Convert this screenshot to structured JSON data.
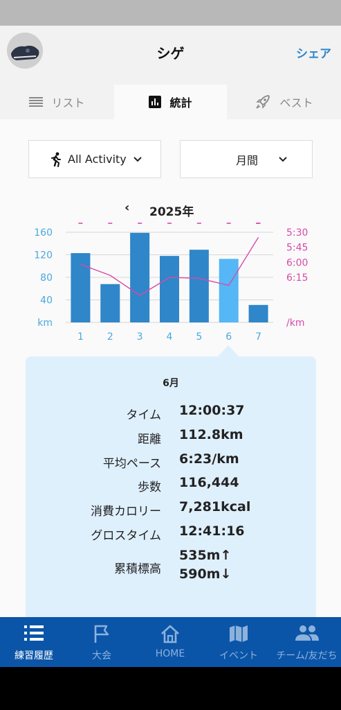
{
  "header": {
    "title": "シゲ",
    "share_label": "シェア"
  },
  "tabs": [
    {
      "label": "リスト",
      "icon": "list-icon"
    },
    {
      "label": "統計",
      "icon": "bar-chart-icon",
      "active": true
    },
    {
      "label": "ベスト",
      "icon": "rocket-icon"
    }
  ],
  "filters": {
    "activity": "All Activity",
    "period": "月間"
  },
  "chart_nav": {
    "year": "2025年"
  },
  "chart_data": {
    "type": "bar",
    "categories": [
      "1",
      "2",
      "3",
      "4",
      "5",
      "6",
      "7"
    ],
    "series": [
      {
        "values": [
          123,
          68,
          159,
          118,
          129,
          112.8,
          31
        ],
        "axis": "left",
        "unit": "km",
        "color": "#2f86c9"
      },
      {
        "values": [
          362,
          373,
          393,
          375,
          376,
          383,
          335
        ],
        "axis": "right",
        "unit": "/km",
        "type": "line",
        "color": "#d84aa8",
        "value_format": "seconds per km"
      }
    ],
    "selected_index": 5,
    "selected_color": "#55b7f5",
    "left_axis": {
      "ticks": [
        "160",
        "120",
        "80",
        "40"
      ],
      "unit_label": "km",
      "ylim": [
        0,
        160
      ]
    },
    "right_axis": {
      "ticks": [
        "5:30",
        "5:45",
        "6:00",
        "6:15"
      ],
      "unit_label": "/km",
      "ylim_seconds": [
        330,
        420
      ],
      "inverted": true
    },
    "grid": true
  },
  "detail": {
    "month": "6月",
    "rows": [
      {
        "label": "タイム",
        "value": "12:00:37"
      },
      {
        "label": "距離",
        "value": "112.8km"
      },
      {
        "label": "平均ペース",
        "value": "6:23/km"
      },
      {
        "label": "歩数",
        "value": "116,444"
      },
      {
        "label": "消費カロリー",
        "value": "7,281kcal"
      },
      {
        "label": "グロスタイム",
        "value": "12:41:16"
      }
    ],
    "elevation": {
      "label": "累積標高",
      "up": "535m↑",
      "down": "590m↓"
    }
  },
  "bottom_nav": [
    {
      "label": "練習履歴",
      "icon": "list-icon",
      "active": true
    },
    {
      "label": "大会",
      "icon": "flag-icon"
    },
    {
      "label": "HOME",
      "icon": "home-icon"
    },
    {
      "label": "イベント",
      "icon": "map-icon"
    },
    {
      "label": "チーム/友だち",
      "icon": "people-icon"
    }
  ]
}
